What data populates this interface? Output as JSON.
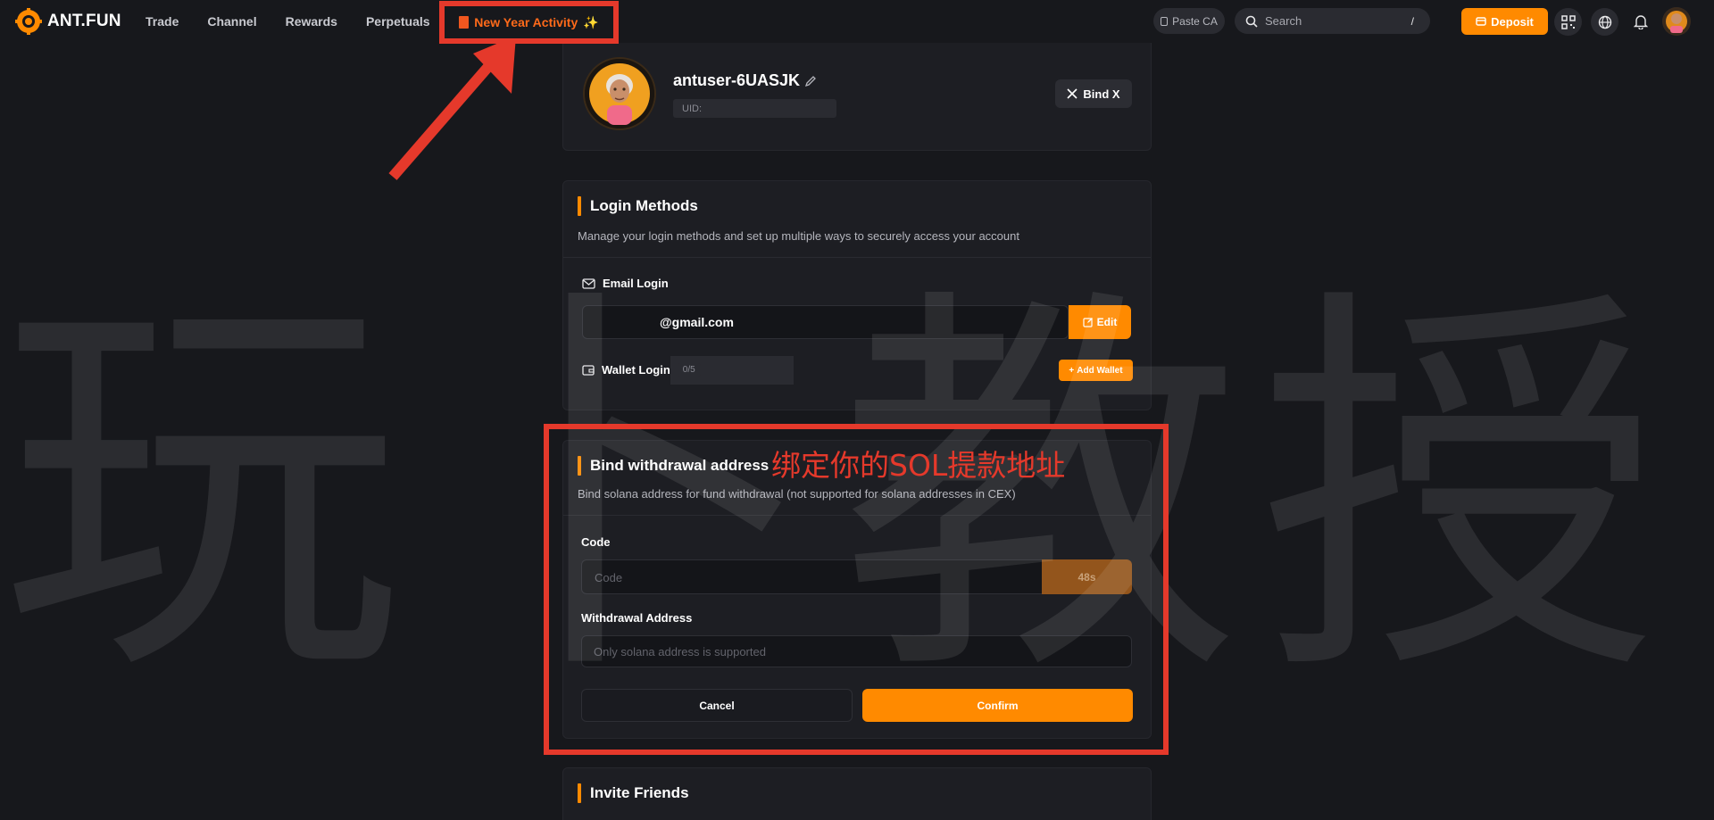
{
  "brand": {
    "name": "ANT.FUN"
  },
  "nav": {
    "items": [
      "Trade",
      "Channel",
      "Rewards",
      "Perpetuals"
    ],
    "special": "New Year Activity"
  },
  "header": {
    "paste_ca": "Paste CA",
    "search_placeholder": "Search",
    "search_shortcut": "/",
    "deposit": "Deposit"
  },
  "profile": {
    "username": "antuser-6UASJK",
    "uid_label": "UID:",
    "bind_x": "Bind X"
  },
  "login_methods": {
    "title": "Login Methods",
    "description": "Manage your login methods and set up multiple ways to securely access your account",
    "email_label": "Email Login",
    "email_value": "@gmail.com",
    "edit": "Edit",
    "wallet_label": "Wallet Login",
    "wallet_count": "0/5",
    "add_wallet": "Add Wallet"
  },
  "bind_withdrawal": {
    "title": "Bind withdrawal address",
    "description": "Bind solana address for fund withdrawal (not supported for solana addresses in CEX)",
    "code_label": "Code",
    "code_placeholder": "Code",
    "timer": "48s",
    "address_label": "Withdrawal Address",
    "address_placeholder": "Only solana address is supported",
    "cancel": "Cancel",
    "confirm": "Confirm"
  },
  "invite": {
    "title": "Invite Friends"
  },
  "annotation": {
    "text": "绑定你的SOL提款地址",
    "watermark": "玩卜教授"
  },
  "colors": {
    "accent": "#ff8a00",
    "annotation": "#e5392b",
    "background": "#17181c"
  }
}
